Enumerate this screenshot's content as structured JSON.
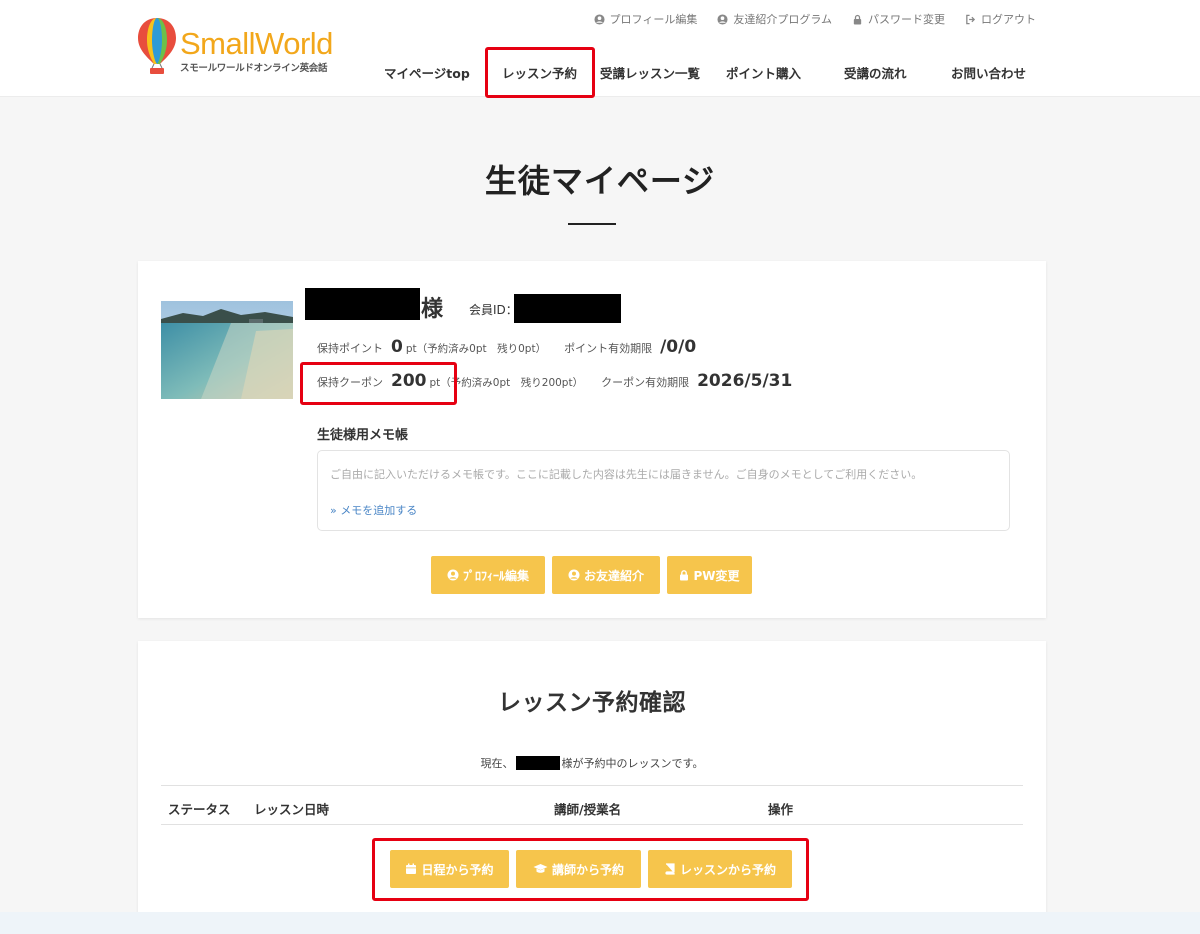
{
  "header": {
    "logo": {
      "word": "SmallWorld",
      "subtitle": "スモールワールドオンライン英会話"
    },
    "top_links": [
      {
        "label": "プロフィール編集",
        "icon": "user-circle-icon"
      },
      {
        "label": "友達紹介プログラム",
        "icon": "user-circle-icon"
      },
      {
        "label": "パスワード変更",
        "icon": "lock-icon"
      },
      {
        "label": "ログアウト",
        "icon": "sign-out-icon"
      }
    ],
    "nav": [
      "マイページtop",
      "レッスン予約",
      "受講レッスン一覧",
      "ポイント購入",
      "受講の流れ",
      "お問い合わせ"
    ]
  },
  "page": {
    "title": "生徒マイページ"
  },
  "profile": {
    "honorific": "様",
    "member_id_label": "会員ID：",
    "points": {
      "label": "保持ポイント",
      "value": "0",
      "unit": "pt",
      "detail": "（予約済み0pt　残り0pt）",
      "expiry_label": "ポイント有効期限",
      "expiry_value": "/0/0"
    },
    "coupon": {
      "label": "保持クーポン",
      "value": "200",
      "unit": "pt",
      "detail": "（予約済み0pt　残り200pt）",
      "expiry_label": "クーポン有効期限",
      "expiry_value": "2026/5/31"
    },
    "memo": {
      "title": "生徒様用メモ帳",
      "placeholder": "ご自由に記入いただけるメモ帳です。ここに記載した内容は先生には届きません。ご自身のメモとしてご利用ください。",
      "add_link": "» メモを追加する"
    },
    "buttons": [
      {
        "label": "ﾌﾟﾛﾌｨｰﾙ編集",
        "icon": "user-circle-icon"
      },
      {
        "label": "お友達紹介",
        "icon": "user-circle-icon"
      },
      {
        "label": "PW変更",
        "icon": "lock-icon"
      }
    ]
  },
  "reservations": {
    "title": "レッスン予約確認",
    "intro_prefix": "現在、",
    "intro_suffix": "様が予約中のレッスンです。",
    "columns": [
      "ステータス",
      "レッスン日時",
      "講師/授業名",
      "操作"
    ],
    "buttons": [
      {
        "label": "日程から予約",
        "icon": "calendar-icon"
      },
      {
        "label": "講師から予約",
        "icon": "graduation-cap-icon"
      },
      {
        "label": "レッスンから予約",
        "icon": "book-icon"
      }
    ]
  },
  "colors": {
    "accent_button": "#f6c54c",
    "highlight_box": "#e60012",
    "logo_orange": "#f2a71b"
  }
}
